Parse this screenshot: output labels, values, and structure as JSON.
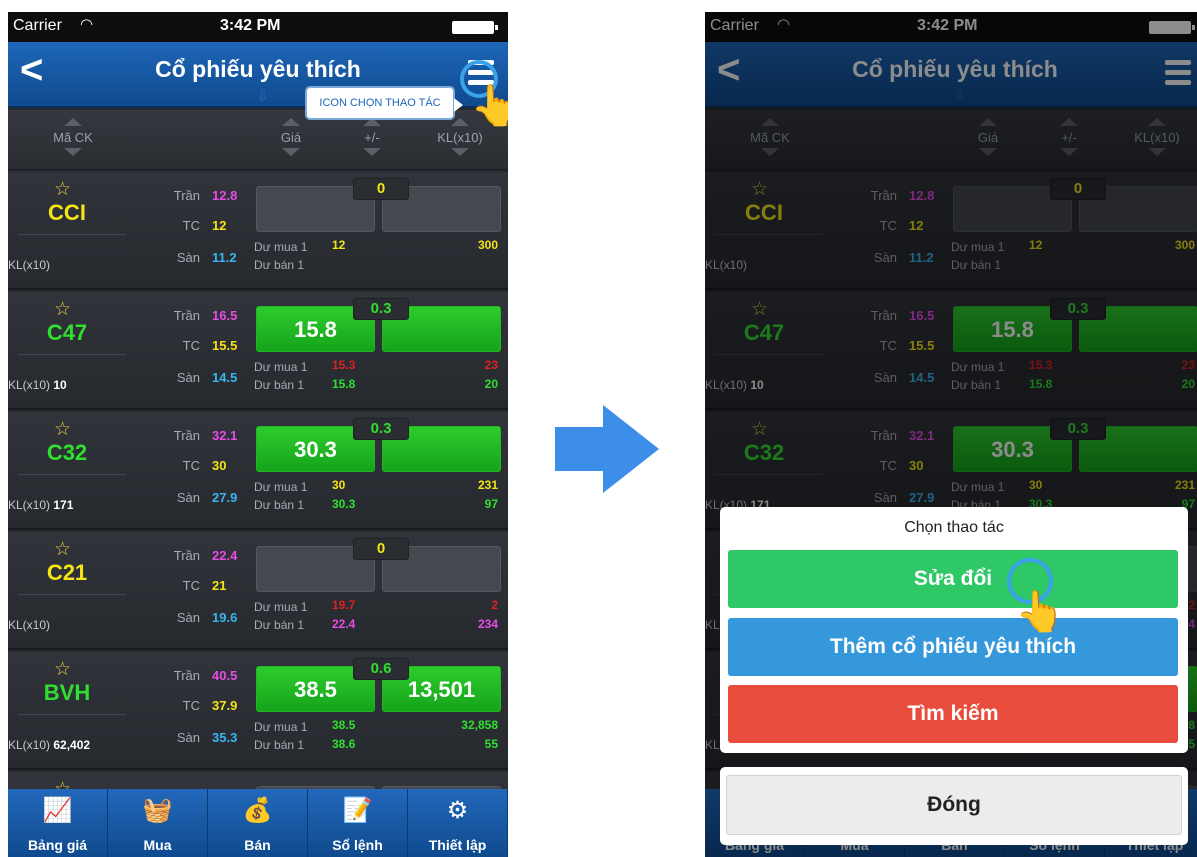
{
  "screen": {
    "status": {
      "carrier": "Carrier",
      "time": "3:42 PM"
    },
    "title": "Cổ phiếu yêu thích",
    "columns": [
      "Mã CK",
      "Giá",
      "+/-",
      "KL(x10)"
    ],
    "labels": {
      "tran": "Trần",
      "tc": "TC",
      "san": "Sàn",
      "du_mua": "Dư mua 1",
      "du_ban": "Dư bán 1",
      "kl": "KL(x10)"
    },
    "stocks": [
      {
        "symbol": "CCI",
        "color": "#f5e416",
        "kl": "",
        "tran": "12.8",
        "tc": "12",
        "san": "11.2",
        "price": "",
        "volume": "",
        "change": "0",
        "change_color": "#f5e416",
        "green": false,
        "mua_price": "12",
        "mua_price_color": "#f5e416",
        "mua_qty": "300",
        "mua_qty_color": "#f5e416",
        "ban_price": "",
        "ban_price_color": "#f5e416",
        "ban_qty": "",
        "ban_qty_color": "#f5e416"
      },
      {
        "symbol": "C47",
        "color": "#2fe02f",
        "kl": "10",
        "tran": "16.5",
        "tc": "15.5",
        "san": "14.5",
        "price": "15.8",
        "volume": "",
        "change": "0.3",
        "change_color": "#2fe02f",
        "green": true,
        "mua_price": "15.3",
        "mua_price_color": "#e02020",
        "mua_qty": "23",
        "mua_qty_color": "#e02020",
        "ban_price": "15.8",
        "ban_price_color": "#2fe02f",
        "ban_qty": "20",
        "ban_qty_color": "#2fe02f"
      },
      {
        "symbol": "C32",
        "color": "#2fe02f",
        "kl": "171",
        "tran": "32.1",
        "tc": "30",
        "san": "27.9",
        "price": "30.3",
        "volume": "",
        "change": "0.3",
        "change_color": "#2fe02f",
        "green": true,
        "mua_price": "30",
        "mua_price_color": "#f5e416",
        "mua_qty": "231",
        "mua_qty_color": "#f5e416",
        "ban_price": "30.3",
        "ban_price_color": "#2fe02f",
        "ban_qty": "97",
        "ban_qty_color": "#2fe02f"
      },
      {
        "symbol": "C21",
        "color": "#f5e416",
        "kl": "",
        "tran": "22.4",
        "tc": "21",
        "san": "19.6",
        "price": "",
        "volume": "",
        "change": "0",
        "change_color": "#f5e416",
        "green": false,
        "mua_price": "19.7",
        "mua_price_color": "#e02020",
        "mua_qty": "2",
        "mua_qty_color": "#e02020",
        "ban_price": "22.4",
        "ban_price_color": "#e84ce8",
        "ban_qty": "234",
        "ban_qty_color": "#e84ce8"
      },
      {
        "symbol": "BVH",
        "color": "#2fe02f",
        "kl": "62,402",
        "tran": "40.5",
        "tc": "37.9",
        "san": "35.3",
        "price": "38.5",
        "volume": "13,501",
        "change": "0.6",
        "change_color": "#2fe02f",
        "green": true,
        "mua_price": "38.5",
        "mua_price_color": "#2fe02f",
        "mua_qty": "32,858",
        "mua_qty_color": "#2fe02f",
        "ban_price": "38.6",
        "ban_price_color": "#2fe02f",
        "ban_qty": "55",
        "ban_qty_color": "#2fe02f"
      }
    ],
    "tabs": [
      {
        "label": "Bảng giá",
        "icon": "chart-icon",
        "glyph": "📈"
      },
      {
        "label": "Mua",
        "icon": "basket-icon",
        "glyph": "🧺"
      },
      {
        "label": "Bán",
        "icon": "money-bag-icon",
        "glyph": "💰"
      },
      {
        "label": "Sổ lệnh",
        "icon": "order-book-icon",
        "glyph": "📝"
      },
      {
        "label": "Thiết lập",
        "icon": "gear-icon",
        "glyph": "⚙"
      }
    ]
  },
  "tooltip": "ICON CHỌN THAO TÁC",
  "action_sheet": {
    "title": "Chọn thao tác",
    "edit": "Sửa đổi",
    "add_favorite": "Thêm cổ phiếu yêu thích",
    "search": "Tìm kiếm",
    "close": "Đóng"
  },
  "colors": {
    "edit": "#2ec866",
    "add_favorite": "#3498db",
    "search": "#e74c3c",
    "navbar": "#1e66b8"
  }
}
